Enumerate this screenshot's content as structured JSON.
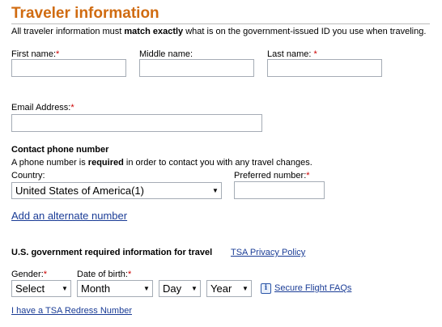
{
  "header": {
    "title": "Traveler information",
    "note_before": "All traveler information must ",
    "note_bold": "match exactly",
    "note_after": " what is on the government-issued ID you use when traveling."
  },
  "name_fields": {
    "first_label": "First name:",
    "middle_label": "Middle name:",
    "last_label": "Last name:",
    "required_mark": "*",
    "first_value": "",
    "middle_value": "",
    "last_value": ""
  },
  "email": {
    "label": "Email Address:",
    "value": ""
  },
  "phone": {
    "heading": "Contact phone number",
    "note_before": "A phone number is ",
    "note_bold": "required",
    "note_after": " in order to contact you with any travel changes.",
    "country_label": "Country:",
    "country_value": "United States of America(1)",
    "preferred_label": "Preferred number:",
    "preferred_value": "",
    "add_alternate_link": "Add an alternate number"
  },
  "tsa": {
    "heading": "U.S. government required information for travel",
    "privacy_link": "TSA Privacy Policy",
    "gender_label": "Gender:",
    "gender_value": "Select",
    "dob_label": "Date of birth:",
    "month_value": "Month",
    "day_value": "Day",
    "year_value": "Year",
    "faq_icon": "info-icon",
    "faq_link": "Secure Flight FAQs",
    "redress_link": "I have a TSA Redress Number"
  },
  "colors": {
    "title": "#d06b10",
    "required": "#cc0000",
    "link": "#1a3c96"
  }
}
